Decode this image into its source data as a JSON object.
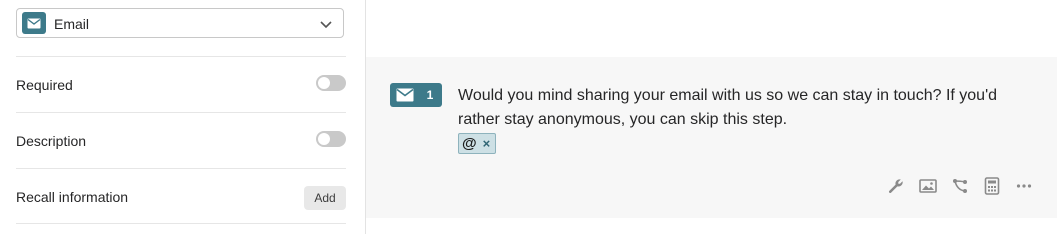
{
  "settings_panel": {
    "question_type": {
      "label": "Email",
      "icon": "envelope-icon",
      "accent": "#3d7a8a"
    },
    "options": [
      {
        "label": "Required",
        "control": "toggle",
        "on": false
      },
      {
        "label": "Description",
        "control": "toggle",
        "on": false
      },
      {
        "label": "Recall information",
        "control": "button",
        "button_label": "Add"
      }
    ]
  },
  "question": {
    "type_icon": "envelope-icon",
    "number": "1",
    "text": "Would you mind sharing your email with us so we can stay in touch? If you'd rather stay anonymous, you can skip this step.",
    "answer_chip": {
      "symbol": "@",
      "remove": "×"
    },
    "toolbar": [
      "wrench-icon",
      "image-icon",
      "logic-branch-icon",
      "calculator-icon",
      "more-icon"
    ]
  },
  "colors": {
    "accent": "#3d7a8a",
    "block_background": "#f7f7f7",
    "chip_background": "#cde0e5"
  }
}
